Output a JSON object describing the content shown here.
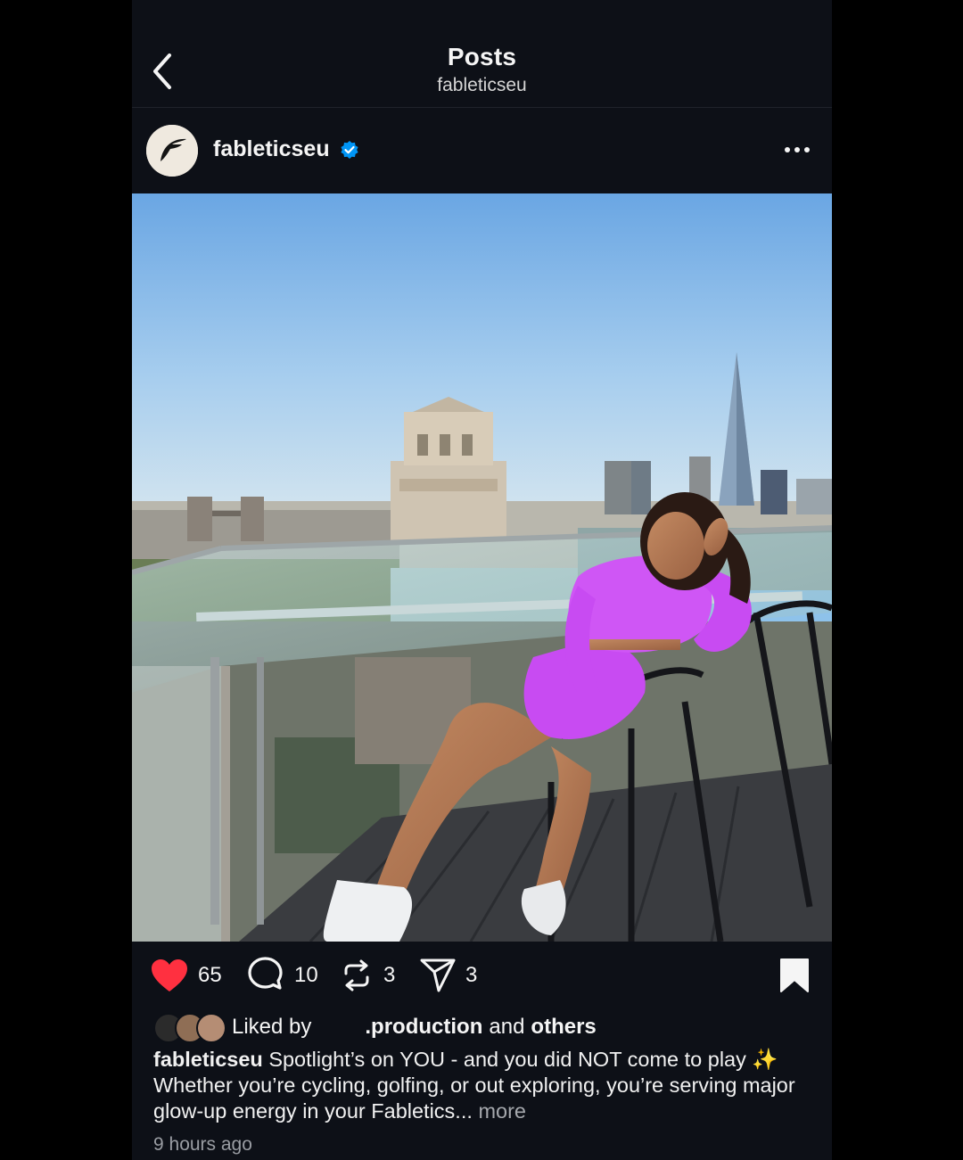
{
  "header": {
    "title": "Posts",
    "subtitle": "fableticseu"
  },
  "post": {
    "username": "fableticseu",
    "verified": true,
    "actions": {
      "likes": "65",
      "comments": "10",
      "reposts": "3",
      "shares": "3"
    },
    "liked_by": {
      "prefix": "Liked by",
      "user": ".production",
      "joiner": "and",
      "others": "others"
    },
    "caption": {
      "username": "fableticseu",
      "text": "Spotlight’s on YOU - and you did NOT come to play ✨ Whether you’re cycling, golfing, or out exploring, you’re serving major glow-up energy in your Fabletics...",
      "more": "more"
    },
    "timestamp": "9 hours ago"
  },
  "colors": {
    "background": "#0d1017",
    "like_red": "#ff3040",
    "verified_blue": "#0095f6",
    "outfit_purple": "#c84bf2"
  },
  "icons": [
    "back-chevron-icon",
    "verified-badge-icon",
    "more-options-icon",
    "heart-icon",
    "comment-icon",
    "repost-icon",
    "share-icon",
    "bookmark-icon"
  ]
}
